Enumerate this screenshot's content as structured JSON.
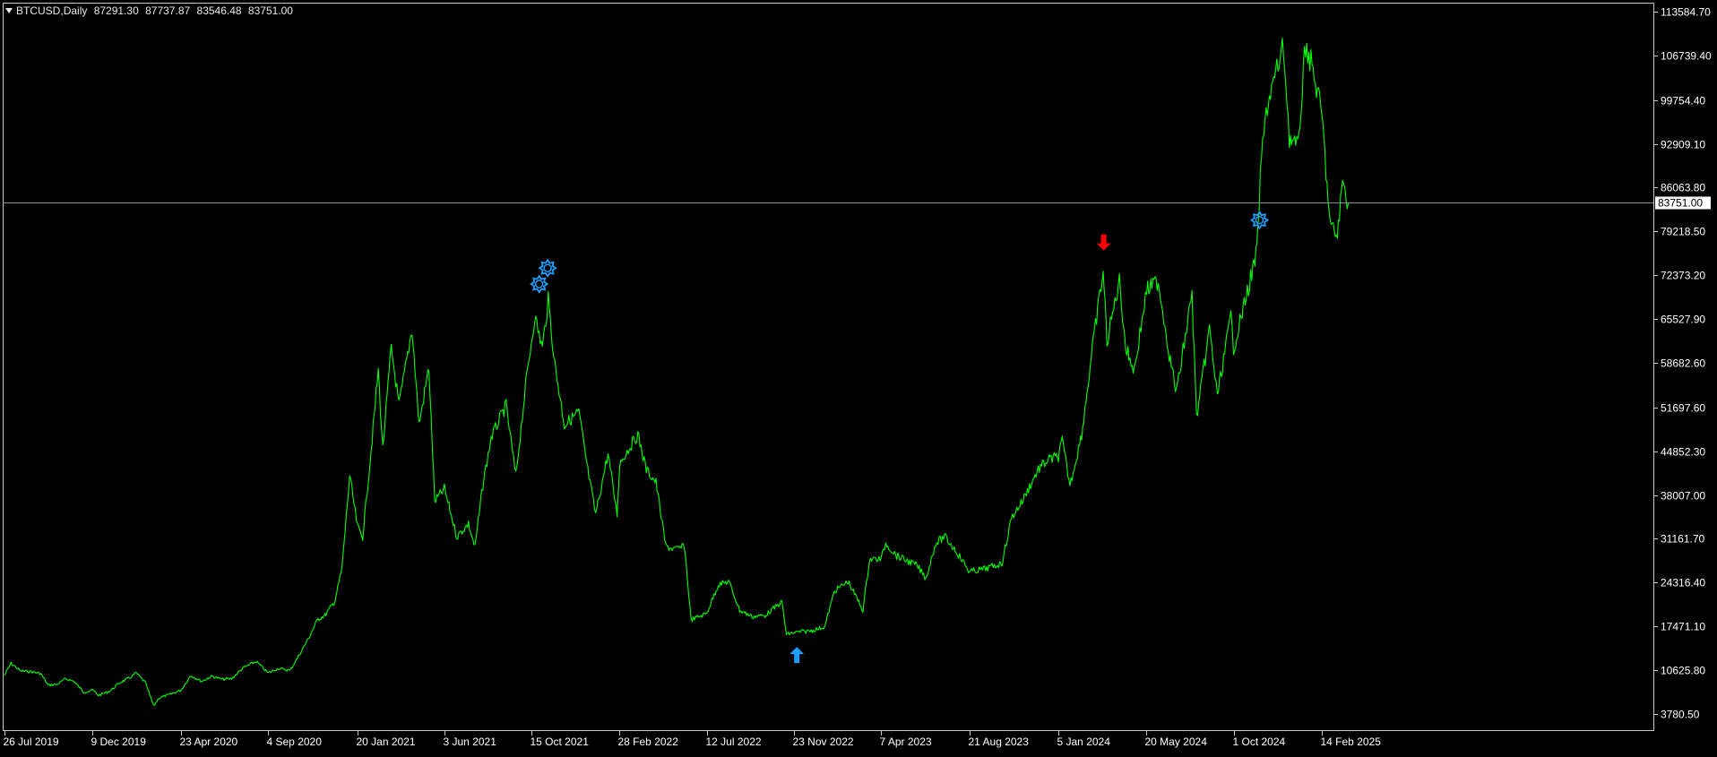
{
  "header": {
    "symbol": "BTCUSD",
    "timeframe": "Daily",
    "open": "87291.30",
    "high": "87737.87",
    "low": "83546.48",
    "close": "83751.00"
  },
  "colors": {
    "background": "#000000",
    "price_line": "#00ff00",
    "axis": "#c8c8c8",
    "current_price_line": "#8a9099",
    "signal_gear": "#1e9fff",
    "arrow_up": "#1e9fff",
    "arrow_down": "#ff0000"
  },
  "chart_data": {
    "type": "line",
    "symbol": "BTCUSD",
    "timeframe": "Daily",
    "grid": false,
    "current_price": 83751.0,
    "current_price_label": "83751.00",
    "ylim": [
      1500,
      116000
    ],
    "y_ticks": [
      {
        "value": 113584.7,
        "label": "113584.70"
      },
      {
        "value": 106739.4,
        "label": "106739.40"
      },
      {
        "value": 99754.4,
        "label": "99754.40"
      },
      {
        "value": 92909.1,
        "label": "92909.10"
      },
      {
        "value": 86063.8,
        "label": "86063.80"
      },
      {
        "value": 79218.5,
        "label": "79218.50"
      },
      {
        "value": 72373.2,
        "label": "72373.20"
      },
      {
        "value": 65527.9,
        "label": "65527.90"
      },
      {
        "value": 58682.6,
        "label": "58682.60"
      },
      {
        "value": 51697.6,
        "label": "51697.60"
      },
      {
        "value": 44852.3,
        "label": "44852.30"
      },
      {
        "value": 38007.0,
        "label": "38007.00"
      },
      {
        "value": 31161.7,
        "label": "31161.70"
      },
      {
        "value": 24316.4,
        "label": "24316.40"
      },
      {
        "value": 17471.1,
        "label": "17471.10"
      },
      {
        "value": 10625.8,
        "label": "10625.80"
      },
      {
        "value": 3780.5,
        "label": "3780.50"
      }
    ],
    "x_ticks": [
      {
        "date": "2019-07-26",
        "label": "26 Jul 2019"
      },
      {
        "date": "2019-12-09",
        "label": "9 Dec 2019"
      },
      {
        "date": "2020-04-23",
        "label": "23 Apr 2020"
      },
      {
        "date": "2020-09-04",
        "label": "4 Sep 2020"
      },
      {
        "date": "2021-01-20",
        "label": "20 Jan 2021"
      },
      {
        "date": "2021-06-03",
        "label": "3 Jun 2021"
      },
      {
        "date": "2021-10-15",
        "label": "15 Oct 2021"
      },
      {
        "date": "2022-02-28",
        "label": "28 Feb 2022"
      },
      {
        "date": "2022-07-12",
        "label": "12 Jul 2022"
      },
      {
        "date": "2022-11-23",
        "label": "23 Nov 2022"
      },
      {
        "date": "2023-04-07",
        "label": "7 Apr 2023"
      },
      {
        "date": "2023-08-21",
        "label": "21 Aug 2023"
      },
      {
        "date": "2024-01-05",
        "label": "5 Jan 2024"
      },
      {
        "date": "2024-05-20",
        "label": "20 May 2024"
      },
      {
        "date": "2024-10-01",
        "label": "1 Oct 2024"
      },
      {
        "date": "2025-02-14",
        "label": "14 Feb 2025"
      }
    ],
    "series": [
      {
        "points": [
          [
            "2019-07-26",
            9800
          ],
          [
            "2019-08-05",
            11700
          ],
          [
            "2019-08-20",
            10500
          ],
          [
            "2019-09-05",
            10400
          ],
          [
            "2019-09-20",
            10100
          ],
          [
            "2019-10-01",
            8300
          ],
          [
            "2019-10-15",
            8400
          ],
          [
            "2019-10-28",
            9300
          ],
          [
            "2019-11-10",
            8900
          ],
          [
            "2019-11-25",
            7200
          ],
          [
            "2019-12-09",
            7500
          ],
          [
            "2019-12-18",
            6700
          ],
          [
            "2020-01-05",
            7400
          ],
          [
            "2020-01-20",
            8700
          ],
          [
            "2020-02-05",
            9500
          ],
          [
            "2020-02-14",
            10200
          ],
          [
            "2020-02-28",
            8700
          ],
          [
            "2020-03-12",
            5000
          ],
          [
            "2020-03-20",
            6300
          ],
          [
            "2020-04-05",
            6800
          ],
          [
            "2020-04-23",
            7500
          ],
          [
            "2020-05-08",
            9800
          ],
          [
            "2020-05-25",
            8900
          ],
          [
            "2020-06-10",
            9700
          ],
          [
            "2020-06-25",
            9200
          ],
          [
            "2020-07-10",
            9300
          ],
          [
            "2020-07-28",
            11000
          ],
          [
            "2020-08-17",
            12000
          ],
          [
            "2020-09-04",
            10200
          ],
          [
            "2020-09-20",
            10900
          ],
          [
            "2020-10-08",
            10600
          ],
          [
            "2020-10-21",
            12800
          ],
          [
            "2020-11-05",
            15500
          ],
          [
            "2020-11-20",
            18600
          ],
          [
            "2020-12-01",
            19200
          ],
          [
            "2020-12-16",
            21400
          ],
          [
            "2020-12-27",
            26500
          ],
          [
            "2021-01-08",
            41000
          ],
          [
            "2021-01-20",
            33000
          ],
          [
            "2021-01-28",
            31500
          ],
          [
            "2021-02-10",
            45000
          ],
          [
            "2021-02-21",
            57500
          ],
          [
            "2021-02-28",
            45200
          ],
          [
            "2021-03-13",
            61000
          ],
          [
            "2021-03-25",
            52000
          ],
          [
            "2021-04-14",
            64000
          ],
          [
            "2021-04-25",
            49000
          ],
          [
            "2021-05-10",
            58000
          ],
          [
            "2021-05-19",
            37000
          ],
          [
            "2021-06-03",
            39000
          ],
          [
            "2021-06-22",
            31500
          ],
          [
            "2021-07-10",
            33500
          ],
          [
            "2021-07-20",
            29800
          ],
          [
            "2021-08-01",
            39500
          ],
          [
            "2021-08-14",
            47000
          ],
          [
            "2021-09-06",
            52000
          ],
          [
            "2021-09-21",
            41000
          ],
          [
            "2021-10-06",
            55000
          ],
          [
            "2021-10-20",
            66000
          ],
          [
            "2021-11-01",
            61000
          ],
          [
            "2021-11-10",
            68500
          ],
          [
            "2021-11-20",
            58500
          ],
          [
            "2021-12-05",
            49000
          ],
          [
            "2021-12-27",
            51000
          ],
          [
            "2022-01-10",
            41800
          ],
          [
            "2022-01-22",
            35000
          ],
          [
            "2022-02-10",
            44500
          ],
          [
            "2022-02-24",
            35000
          ],
          [
            "2022-02-28",
            43000
          ],
          [
            "2022-03-28",
            47500
          ],
          [
            "2022-04-10",
            42000
          ],
          [
            "2022-04-25",
            40000
          ],
          [
            "2022-05-10",
            30000
          ],
          [
            "2022-05-25",
            29500
          ],
          [
            "2022-06-08",
            30000
          ],
          [
            "2022-06-18",
            18500
          ],
          [
            "2022-07-12",
            19500
          ],
          [
            "2022-07-30",
            24000
          ],
          [
            "2022-08-15",
            24500
          ],
          [
            "2022-09-01",
            20000
          ],
          [
            "2022-09-20",
            19000
          ],
          [
            "2022-10-10",
            19200
          ],
          [
            "2022-11-05",
            21300
          ],
          [
            "2022-11-12",
            16200
          ],
          [
            "2022-11-23",
            16500
          ],
          [
            "2022-12-20",
            16800
          ],
          [
            "2023-01-10",
            17400
          ],
          [
            "2023-01-25",
            23000
          ],
          [
            "2023-02-15",
            24500
          ],
          [
            "2023-03-10",
            20000
          ],
          [
            "2023-03-20",
            28000
          ],
          [
            "2023-04-07",
            28000
          ],
          [
            "2023-04-14",
            30500
          ],
          [
            "2023-05-01",
            28500
          ],
          [
            "2023-06-01",
            27000
          ],
          [
            "2023-06-15",
            25000
          ],
          [
            "2023-06-30",
            30500
          ],
          [
            "2023-07-14",
            31500
          ],
          [
            "2023-08-01",
            29200
          ],
          [
            "2023-08-21",
            26000
          ],
          [
            "2023-09-15",
            26500
          ],
          [
            "2023-10-10",
            27300
          ],
          [
            "2023-10-25",
            34500
          ],
          [
            "2023-11-10",
            37000
          ],
          [
            "2023-12-05",
            42000
          ],
          [
            "2023-12-20",
            43500
          ],
          [
            "2024-01-05",
            44000
          ],
          [
            "2024-01-11",
            46500
          ],
          [
            "2024-01-23",
            39500
          ],
          [
            "2024-02-10",
            47500
          ],
          [
            "2024-02-28",
            62000
          ],
          [
            "2024-03-14",
            73000
          ],
          [
            "2024-03-20",
            62000
          ],
          [
            "2024-04-08",
            71500
          ],
          [
            "2024-04-18",
            61000
          ],
          [
            "2024-05-01",
            57500
          ],
          [
            "2024-05-20",
            70000
          ],
          [
            "2024-06-07",
            71500
          ],
          [
            "2024-06-24",
            60000
          ],
          [
            "2024-07-05",
            54000
          ],
          [
            "2024-07-29",
            69500
          ],
          [
            "2024-08-05",
            50000
          ],
          [
            "2024-08-25",
            64000
          ],
          [
            "2024-09-06",
            53500
          ],
          [
            "2024-09-27",
            66000
          ],
          [
            "2024-10-01",
            61000
          ],
          [
            "2024-10-29",
            72500
          ],
          [
            "2024-11-06",
            76000
          ],
          [
            "2024-11-13",
            91000
          ],
          [
            "2024-11-22",
            99000
          ],
          [
            "2024-12-05",
            103800
          ],
          [
            "2024-12-17",
            108000
          ],
          [
            "2024-12-26",
            94000
          ],
          [
            "2025-01-08",
            92000
          ],
          [
            "2025-01-20",
            108500
          ],
          [
            "2025-01-30",
            105000
          ],
          [
            "2025-02-14",
            97500
          ],
          [
            "2025-02-27",
            80000
          ],
          [
            "2025-03-10",
            78500
          ],
          [
            "2025-03-18",
            87000
          ],
          [
            "2025-03-27",
            83751
          ]
        ]
      }
    ],
    "markers": [
      {
        "type": "gear",
        "date": "2021-10-27",
        "value": 71000
      },
      {
        "type": "gear",
        "date": "2021-11-09",
        "value": 73500
      },
      {
        "type": "arrow-down",
        "date": "2024-03-15",
        "value": 77500
      },
      {
        "type": "arrow-up",
        "date": "2022-11-28",
        "value": 13000
      },
      {
        "type": "gear",
        "date": "2024-11-10",
        "value": 81000
      }
    ]
  }
}
